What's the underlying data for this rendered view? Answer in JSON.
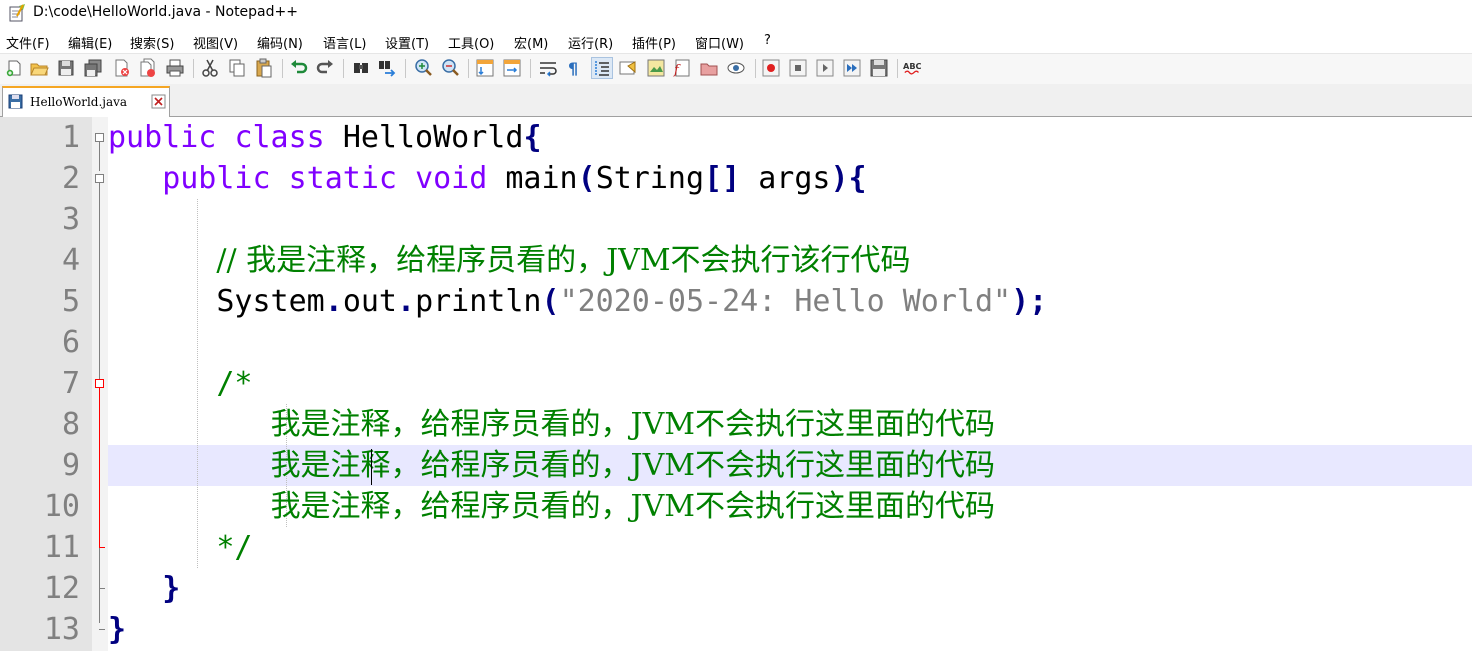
{
  "window": {
    "title": "D:\\code\\HelloWorld.java - Notepad++"
  },
  "menu": [
    "文件(F)",
    "编辑(E)",
    "搜索(S)",
    "视图(V)",
    "编码(N)",
    "语言(L)",
    "设置(T)",
    "工具(O)",
    "宏(M)",
    "运行(R)",
    "插件(P)",
    "窗口(W)",
    "?"
  ],
  "toolbar": {
    "icons": [
      "new-file-icon",
      "open-file-icon",
      "save-icon",
      "save-all-icon",
      "close-icon",
      "close-all-icon",
      "print-icon",
      "cut-icon",
      "copy-icon",
      "paste-icon",
      "undo-icon",
      "redo-icon",
      "find-icon",
      "replace-icon",
      "zoom-in-icon",
      "zoom-out-icon",
      "sync-vertical-icon",
      "sync-horizontal-icon",
      "word-wrap-icon",
      "show-all-chars-icon",
      "indent-guide-icon",
      "user-lang-icon",
      "doc-map-icon",
      "function-list-icon",
      "folder-workspace-icon",
      "monitor-icon",
      "record-macro-icon",
      "stop-macro-icon",
      "play-macro-icon",
      "run-macro-multiple-icon",
      "save-macro-icon",
      "spell-check-icon"
    ],
    "spell_check_label": "ABC"
  },
  "tabs": [
    {
      "label": "HelloWorld.java",
      "active": true
    }
  ],
  "editor": {
    "line_numbers": [
      "1",
      "2",
      "3",
      "4",
      "5",
      "6",
      "7",
      "8",
      "9",
      "10",
      "11",
      "12",
      "13"
    ],
    "current_line": 9,
    "code": {
      "l1_kw1": "public",
      "l1_kw2": "class",
      "l1_name": "HelloWorld",
      "l1_brace": "{",
      "l2_kw1": "public",
      "l2_kw2": "static",
      "l2_kw3": "void",
      "l2_method": "main",
      "l2_paren_open": "(",
      "l2_type": "String",
      "l2_brackets": "[]",
      "l2_arg": "args",
      "l2_paren_close": "){",
      "l4_comment": "// 我是注释，给程序员看的，JVM不会执行该行代码",
      "l5_obj": "System",
      "l5_dot1": ".",
      "l5_out": "out",
      "l5_dot2": ".",
      "l5_method": "println",
      "l5_paren_open": "(",
      "l5_string": "\"2020-05-24: Hello World\"",
      "l5_paren_close": ");",
      "l7_comment": "/*",
      "l8_comment": "我是注释，给程序员看的，JVM不会执行这里面的代码",
      "l9_comment": "我是注释，给程序员看的，JVM不会执行这里面的代码",
      "l10_comment": "我是注释，给程序员看的，JVM不会执行这里面的代码",
      "l11_comment": "*/",
      "l12_brace": "}",
      "l13_brace": "}"
    }
  },
  "colors": {
    "keyword": "#8000ff",
    "operator": "#000080",
    "comment": "#008000",
    "string": "#808080",
    "current_line": "#e8e8ff",
    "fold_marker": "#ff0000"
  }
}
